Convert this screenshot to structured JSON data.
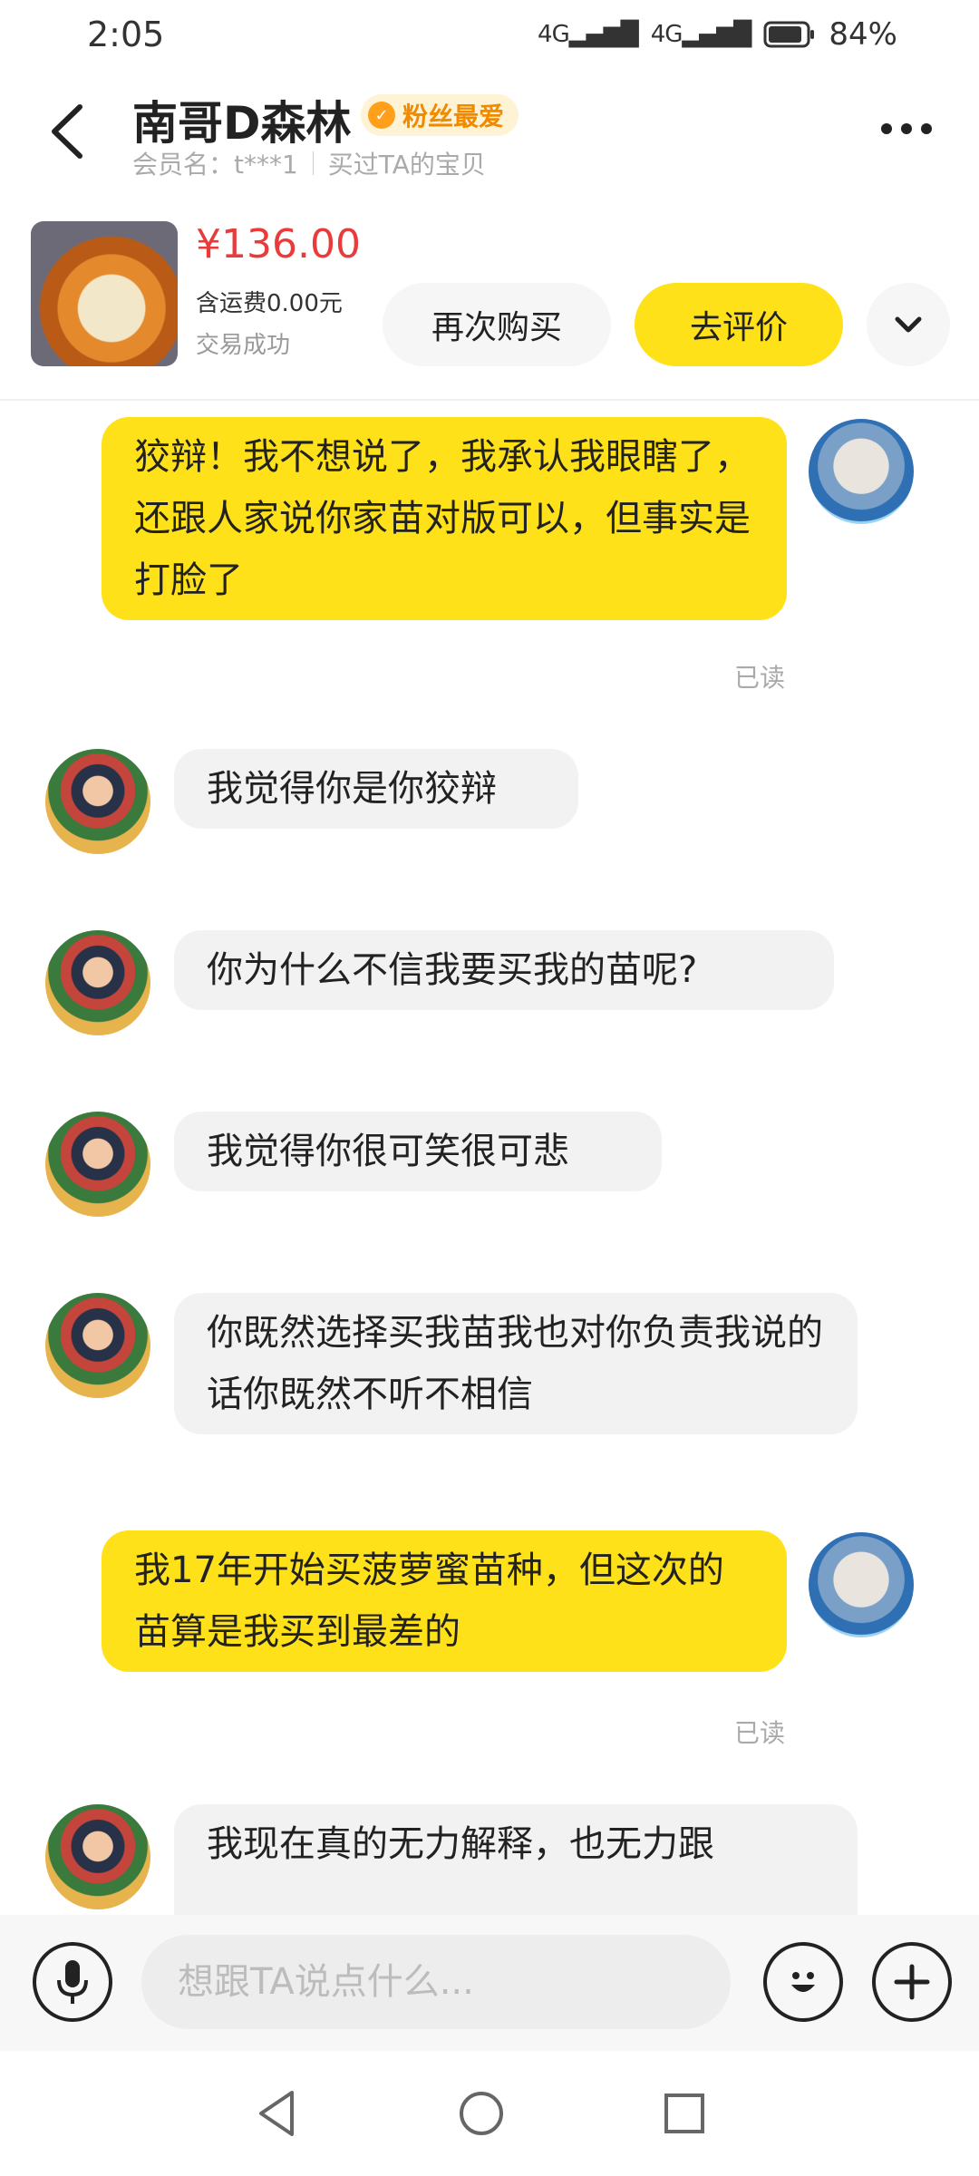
{
  "status_bar": {
    "time": "2:05",
    "signal_1": "4G",
    "signal_2": "4G",
    "battery": "84%"
  },
  "header": {
    "title": "南哥D森林",
    "badge": "粉丝最爱",
    "member_label": "会员名：t***1",
    "bought_label": "买过TA的宝贝"
  },
  "order": {
    "price": "¥136.00",
    "shipping": "含运费0.00元",
    "status": "交易成功",
    "rebuy_label": "再次购买",
    "review_label": "去评价"
  },
  "messages": [
    {
      "sender": "me",
      "text": "狡辩！我不想说了，我承认我眼瞎了，还跟人家说你家苗对版可以，但事实是打脸了",
      "read": "已读"
    },
    {
      "sender": "them",
      "text": "我觉得你是你狡辩"
    },
    {
      "sender": "them",
      "text": "你为什么不信我要买我的苗呢?"
    },
    {
      "sender": "them",
      "text": "我觉得你很可笑很可悲"
    },
    {
      "sender": "them",
      "text": "你既然选择买我苗我也对你负责我说的话你既然不听不相信"
    },
    {
      "sender": "me",
      "text": "我17年开始买菠萝蜜苗种，但这次的苗算是我买到最差的",
      "read": "已读"
    },
    {
      "sender": "them",
      "text": "我现在真的无力解释，也无力跟"
    }
  ],
  "input": {
    "placeholder": "想跟TA说点什么..."
  },
  "colors": {
    "accent": "#ffe11a",
    "price": "#e93b3b",
    "badge_text": "#f08a00"
  }
}
